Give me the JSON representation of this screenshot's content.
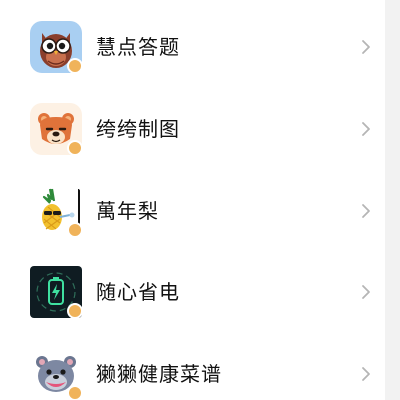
{
  "list": {
    "items": [
      {
        "label": "慧点答题",
        "icon": "owl-icon"
      },
      {
        "label": "绔绔制图",
        "icon": "bear-icon"
      },
      {
        "label": "萬年梨",
        "icon": "pineapple-icon"
      },
      {
        "label": "随心省电",
        "icon": "battery-icon"
      },
      {
        "label": "獭獭健康菜谱",
        "icon": "otter-icon"
      }
    ]
  },
  "colors": {
    "owl_bg": "#a9cff2",
    "bear_bg": "#fdf1e4",
    "battery_bg": "#0f1c22",
    "otter_bg": "#ffffff",
    "chevron": "#b5b5b5"
  }
}
